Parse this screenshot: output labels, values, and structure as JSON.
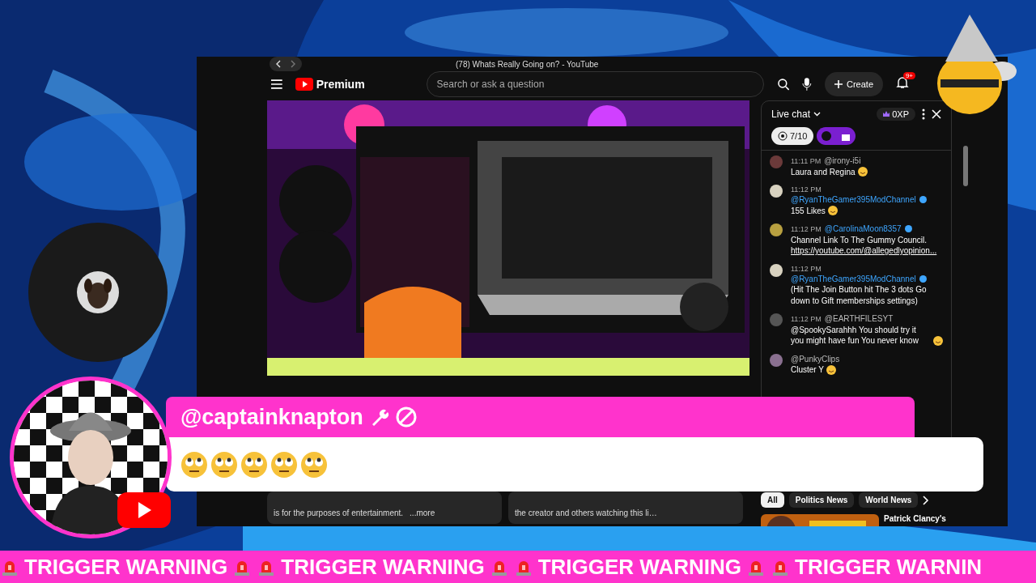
{
  "browser": {
    "tab_title": "(78) Whats Really Going on? - YouTube"
  },
  "youtube": {
    "brand": "Premium",
    "search": {
      "placeholder": "Search or ask a question"
    },
    "create_label": "Create",
    "notification_badge": "9+"
  },
  "live_chat": {
    "title": "Live chat",
    "xp": "0XP",
    "goal": "7/10",
    "gifts_on": true,
    "messages": [
      {
        "time": "11:11 PM",
        "author": "@irony-i5i",
        "verified": false,
        "text": "Laura and Regina",
        "emoji": true,
        "color": "#6b3a3a"
      },
      {
        "time": "11:12 PM",
        "author": "@RyanTheGamer395ModChannel",
        "verified": true,
        "text": "155 Likes",
        "emoji": true,
        "color": "#d8d2c0"
      },
      {
        "time": "11:12 PM",
        "author": "@CarolinaMoon8357",
        "verified": true,
        "text": "Channel Link To The Gummy Council.",
        "link": "https://youtube.com/@allegedlyopinion...",
        "emoji": false,
        "color": "#b8a040"
      },
      {
        "time": "11:12 PM",
        "author": "@RyanTheGamer395ModChannel",
        "verified": true,
        "text": "(Hit The Join Button hit The 3 dots Go down to Gift memberships settings)",
        "emoji": false,
        "color": "#d8d2c0"
      },
      {
        "time": "11:12 PM",
        "author": "@EARTHFILESYT",
        "verified": false,
        "text": "@SpookySarahhh You should try it you might have fun You never know",
        "emoji": true,
        "color": "#555555"
      },
      {
        "author": "@PunkyClips",
        "verified": false,
        "text": "Cluster Y",
        "emoji": true,
        "color": "#8a7090"
      }
    ]
  },
  "description": {
    "text": "is for the purposes of entertainment.",
    "more": "...more"
  },
  "comments_prompt": "the creator and others watching this li…",
  "chips": [
    {
      "label": "All",
      "selected": true
    },
    {
      "label": "Politics News",
      "selected": false
    },
    {
      "label": "World News",
      "selected": false
    }
  ],
  "recommendation": {
    "title": "Patrick Clancy's"
  },
  "alert": {
    "author": "@captainknapton"
  },
  "ticker": [
    "TRIGGER WARNING",
    "TRIGGER WARNING",
    "TRIGGER WARNING",
    "TRIGGER WARNIN"
  ]
}
